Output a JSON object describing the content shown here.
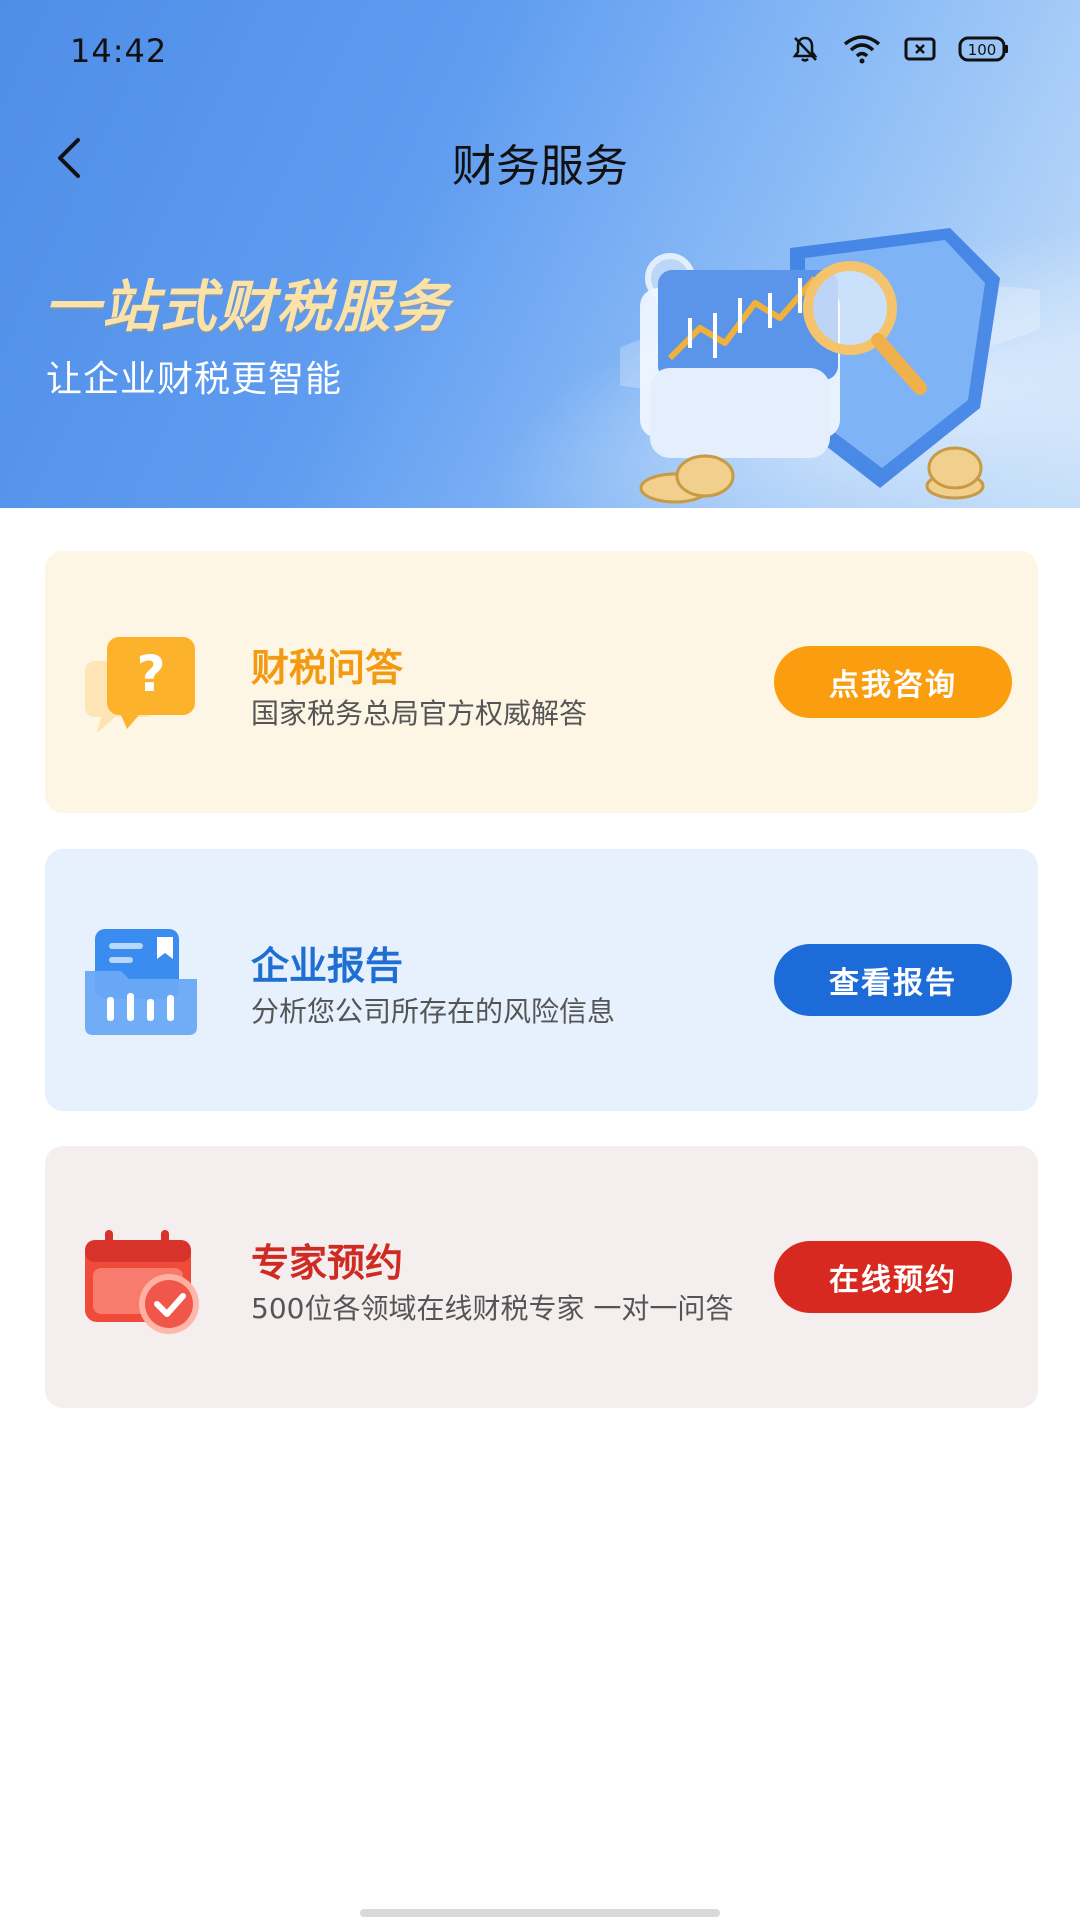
{
  "status_bar": {
    "time": "14:42",
    "battery": "100",
    "icons": [
      "bell-muted-icon",
      "wifi-icon",
      "sim-icon",
      "battery-icon"
    ]
  },
  "nav": {
    "title": "财务服务",
    "back_icon": "chevron-left-icon"
  },
  "banner": {
    "title": "一站式财税服务",
    "subtitle": "让企业财税更智能"
  },
  "cards": [
    {
      "title": "财税问答",
      "desc": "国家税务总局官方权威解答",
      "button": "点我咨询",
      "icon": "question-bubble-icon",
      "accent": "#f29a12"
    },
    {
      "title": "企业报告",
      "desc": "分析您公司所存在的风险信息",
      "button": "查看报告",
      "icon": "report-folder-icon",
      "accent": "#1c6bd8"
    },
    {
      "title": "专家预约",
      "desc": "500位各领域在线财税专家 一对一问答",
      "button": "在线预约",
      "icon": "calendar-check-icon",
      "accent": "#d7291f"
    }
  ]
}
